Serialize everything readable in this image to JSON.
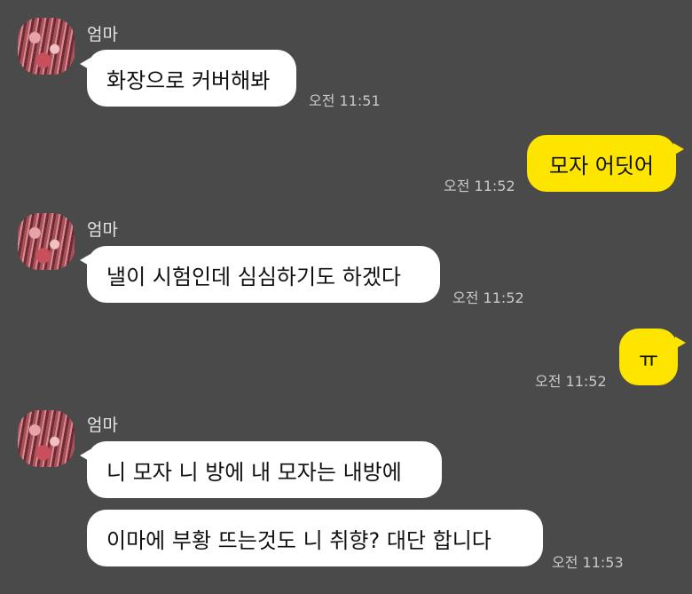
{
  "messages": [
    {
      "sender": "엄마",
      "text": "화장으로 커버해봐",
      "time": "오전 11:51"
    },
    {
      "text": "모자 어딧어",
      "time": "오전 11:52"
    },
    {
      "sender": "엄마",
      "text": "낼이 시험인데 심심하기도 하겠다",
      "time": "오전 11:52"
    },
    {
      "text": "ㅠ",
      "time": "오전 11:52"
    },
    {
      "sender": "엄마",
      "text": "니 모자 니 방에 내 모자는 내방에"
    },
    {
      "text": "이마에 부황 뜨는것도 니 취향? 대단 합니다",
      "time": "오전 11:53"
    }
  ]
}
